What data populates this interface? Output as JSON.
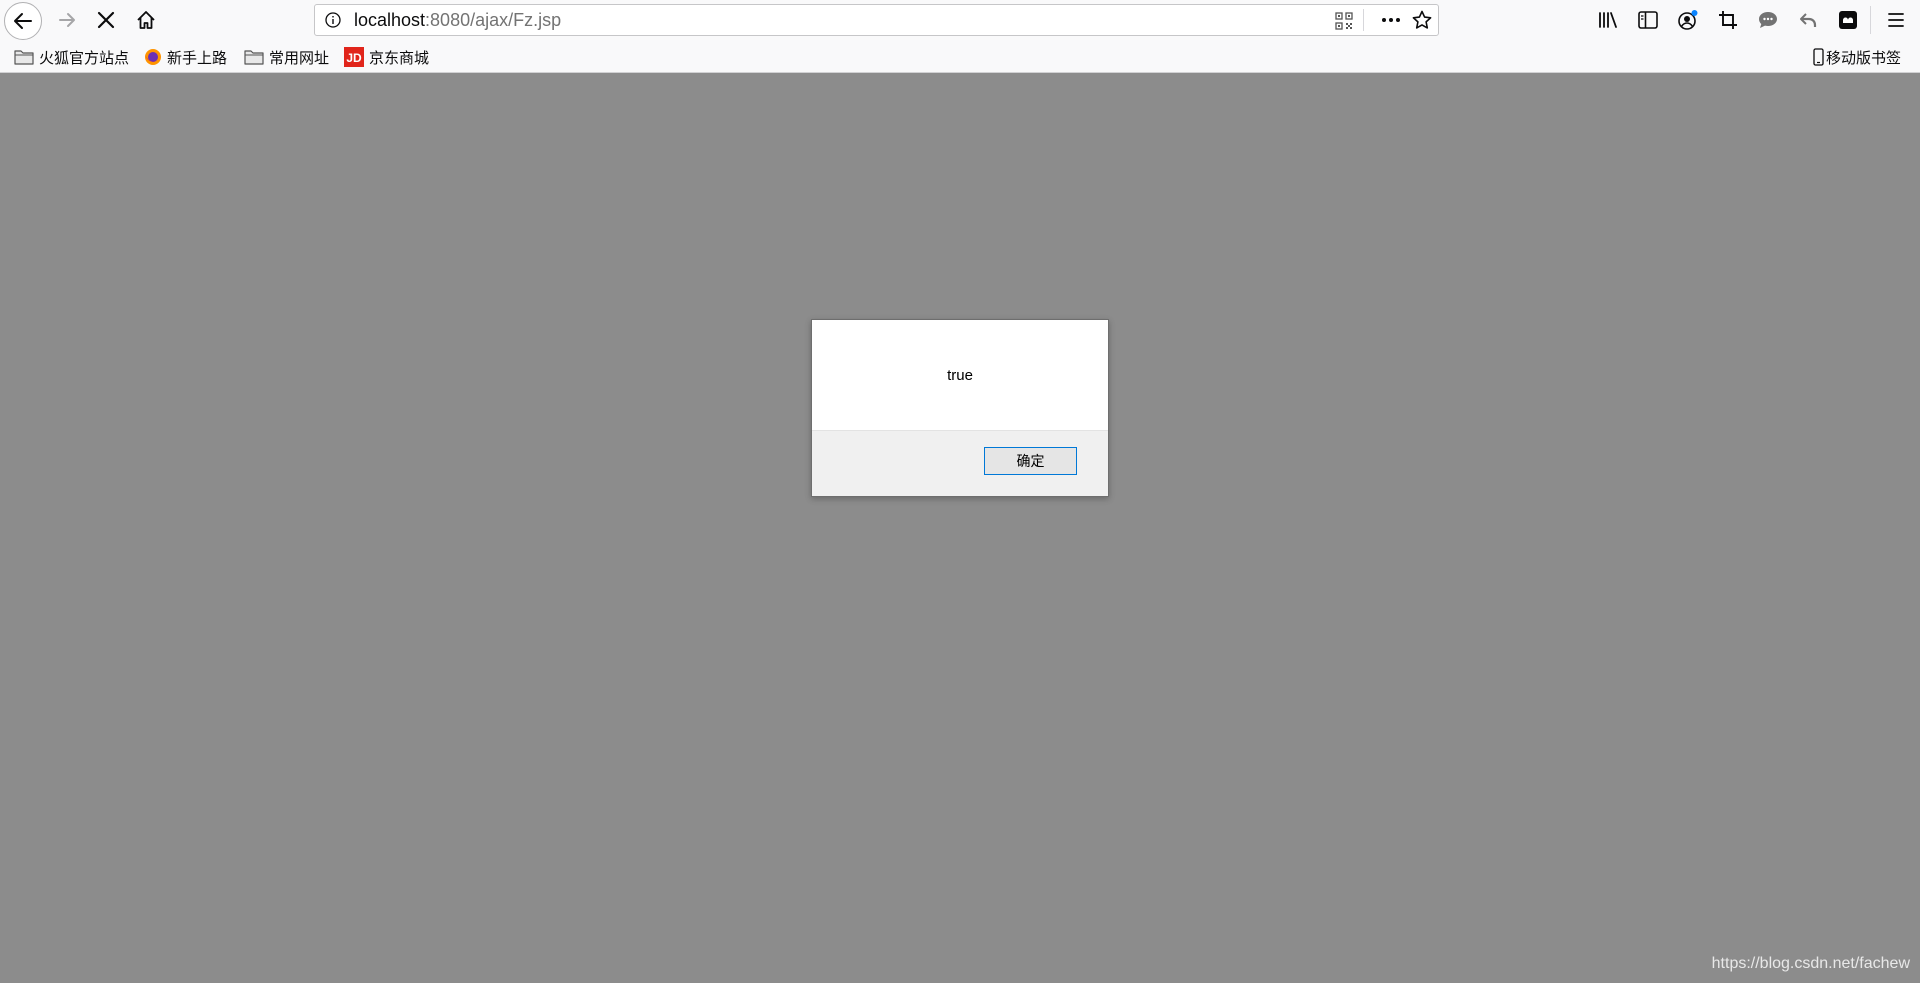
{
  "browser": {
    "url_host": "localhost",
    "url_rest": ":8080/ajax/Fz.jsp",
    "icons": {
      "back": "back-arrow-icon",
      "forward": "forward-arrow-icon",
      "stop": "stop-loading-icon",
      "home": "home-icon",
      "info": "info-icon",
      "qr": "qr-code-icon",
      "more": "page-actions-icon",
      "bookmark": "bookmark-star-icon",
      "library": "library-icon",
      "sidebar": "sidebar-icon",
      "account": "account-icon",
      "screenshot": "screenshot-crop-icon",
      "chat": "chat-icon",
      "undo": "undo-icon",
      "tab": "tab-manager-icon",
      "menu": "hamburger-menu-icon"
    }
  },
  "bookmarks": {
    "items": [
      {
        "label": "火狐官方站点",
        "icon": "folder-icon"
      },
      {
        "label": "新手上路",
        "icon": "firefox-icon"
      },
      {
        "label": "常用网址",
        "icon": "folder-icon"
      },
      {
        "label": "京东商城",
        "icon": "jd-icon"
      }
    ],
    "mobile_label": "移动版书签"
  },
  "dialog": {
    "message": "true",
    "ok_label": "确定"
  },
  "watermark": "https://blog.csdn.net/fachew",
  "colors": {
    "overlay": "#8c8c8c",
    "toolbar": "#f9f9fa",
    "button_focus": "#0078d7",
    "jd_red": "#e1251b",
    "account_dot": "#0a84ff"
  }
}
